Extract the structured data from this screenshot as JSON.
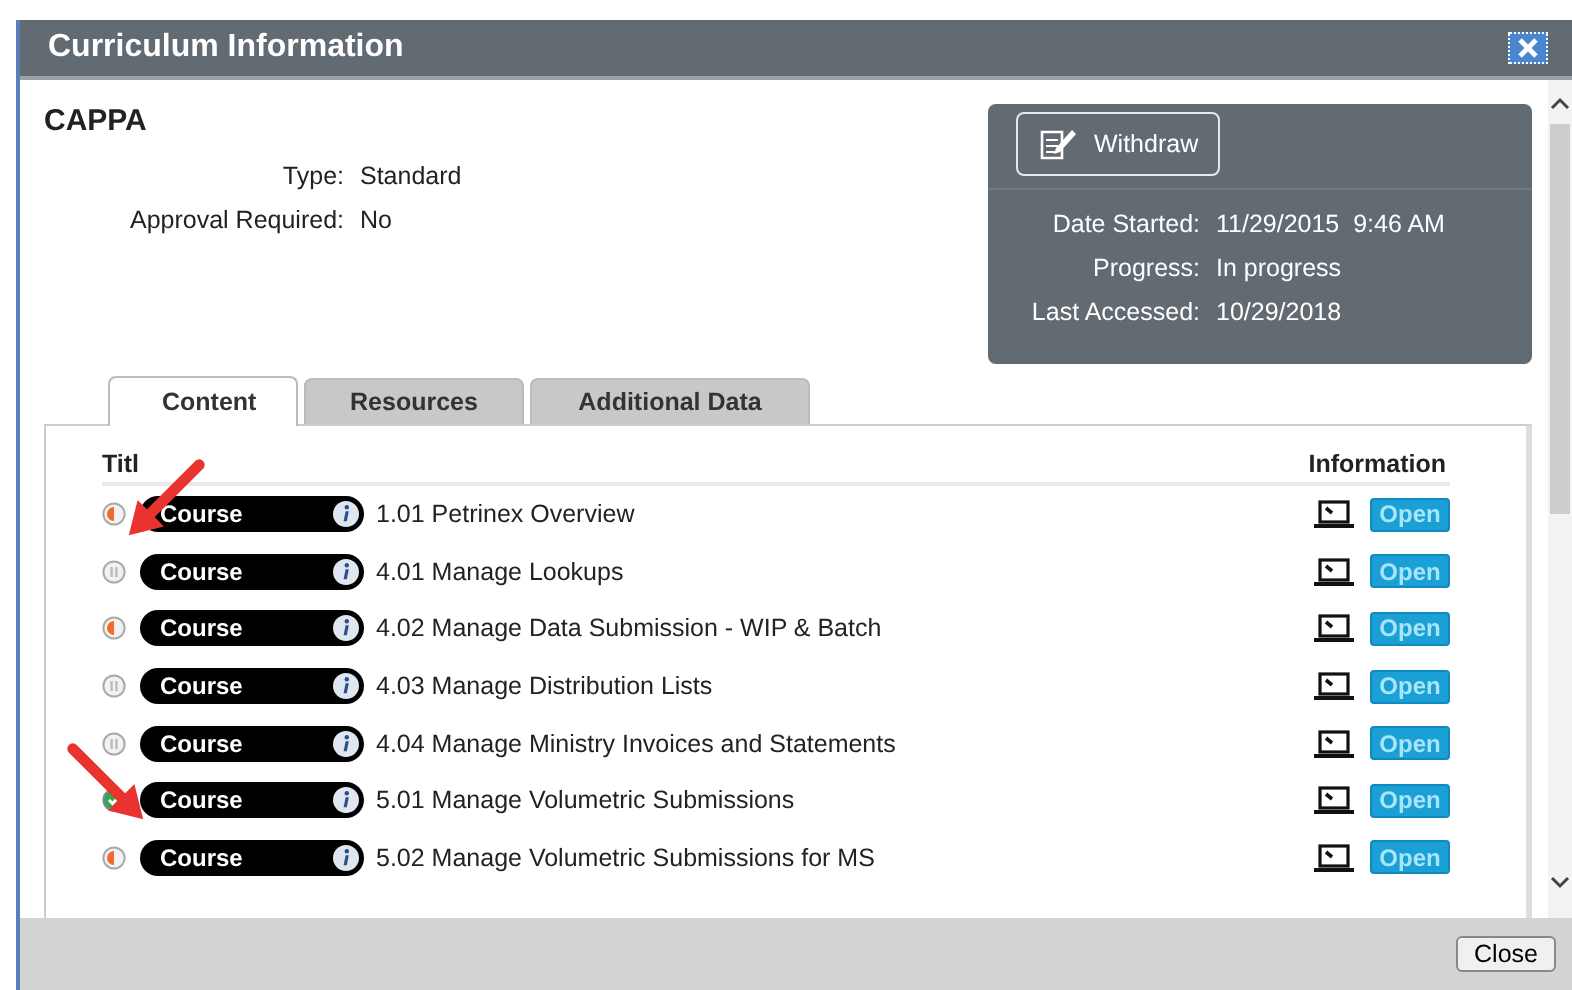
{
  "window": {
    "title": "Curriculum Information"
  },
  "curriculum": {
    "name": "CAPPA",
    "fields": [
      {
        "label": "Type:",
        "value": "Standard"
      },
      {
        "label": "Approval Required:",
        "value": "No"
      }
    ]
  },
  "summary": {
    "button": "Withdraw",
    "fields": [
      {
        "label": "Date Started:",
        "value": "11/29/2015  9:46 AM"
      },
      {
        "label": "Progress:",
        "value": "In progress"
      },
      {
        "label": "Last Accessed:",
        "value": "10/29/2018"
      }
    ]
  },
  "tabs": [
    {
      "label": "Content",
      "selected": true
    },
    {
      "label": "Resources",
      "selected": false
    },
    {
      "label": "Additional Data",
      "selected": false
    }
  ],
  "table": {
    "columns": [
      "Titl",
      "Information"
    ],
    "rows": [
      {
        "kind": "in_progress",
        "type": "Course",
        "title": "1.01 Petrinex Overview",
        "action": "Open"
      },
      {
        "kind": "not_started",
        "type": "Course",
        "title": "4.01 Manage Lookups",
        "action": "Open"
      },
      {
        "kind": "in_progress",
        "type": "Course",
        "title": "4.02 Manage Data Submission - WIP & Batch",
        "action": "Open"
      },
      {
        "kind": "not_started",
        "type": "Course",
        "title": "4.03 Manage Distribution Lists",
        "action": "Open"
      },
      {
        "kind": "not_started",
        "type": "Course",
        "title": "4.04 Manage Ministry Invoices and Statements",
        "action": "Open"
      },
      {
        "kind": "completed",
        "type": "Course",
        "title": "5.01 Manage Volumetric Submissions",
        "action": "Open"
      },
      {
        "kind": "in_progress",
        "type": "Course",
        "title": "5.02 Manage Volumetric Submissions for MS",
        "action": "Open"
      }
    ]
  },
  "footer": {
    "button": "Close"
  }
}
